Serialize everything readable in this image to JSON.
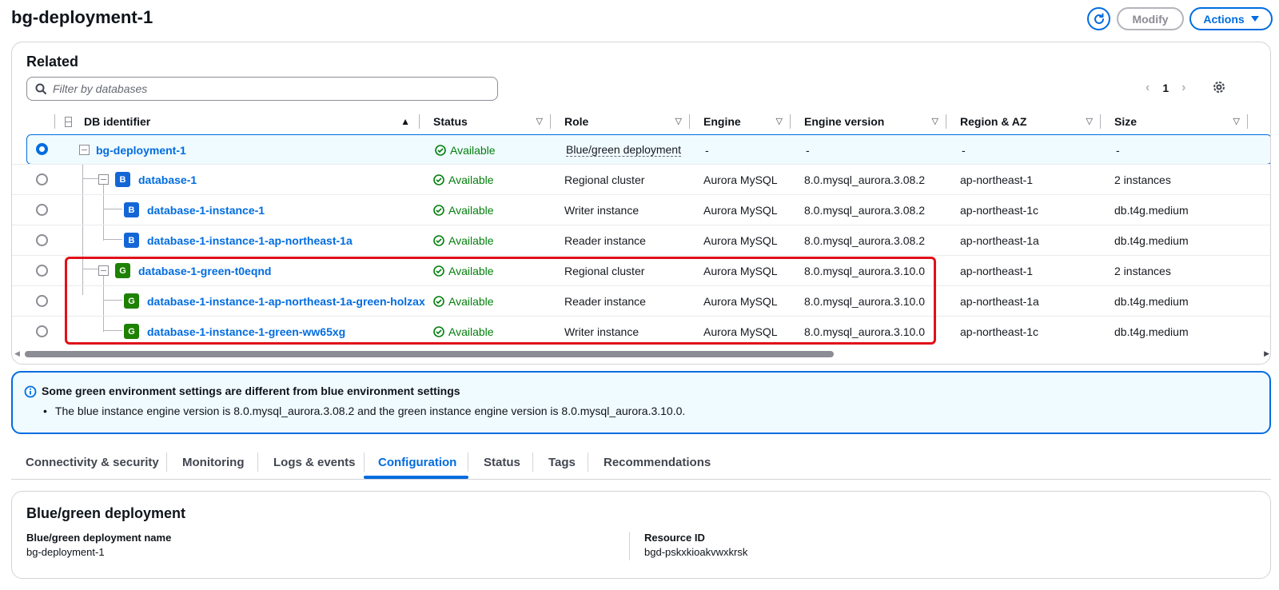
{
  "page": {
    "title": "bg-deployment-1"
  },
  "header_buttons": {
    "modify": "Modify",
    "actions": "Actions"
  },
  "related": {
    "title": "Related",
    "filter_placeholder": "Filter by databases",
    "page_number": "1",
    "columns": [
      "DB identifier",
      "Status",
      "Role",
      "Engine",
      "Engine version",
      "Region & AZ",
      "Size"
    ],
    "rows": [
      {
        "id": "bg-deployment-1",
        "tag": "",
        "status": "Available",
        "role": "Blue/green deployment",
        "engine": "-",
        "version": "-",
        "region": "-",
        "size": "-",
        "selected": true
      },
      {
        "id": "database-1",
        "tag": "B",
        "status": "Available",
        "role": "Regional cluster",
        "engine": "Aurora MySQL",
        "version": "8.0.mysql_aurora.3.08.2",
        "region": "ap-northeast-1",
        "size": "2 instances"
      },
      {
        "id": "database-1-instance-1",
        "tag": "B",
        "status": "Available",
        "role": "Writer instance",
        "engine": "Aurora MySQL",
        "version": "8.0.mysql_aurora.3.08.2",
        "region": "ap-northeast-1c",
        "size": "db.t4g.medium"
      },
      {
        "id": "database-1-instance-1-ap-northeast-1a",
        "tag": "B",
        "status": "Available",
        "role": "Reader instance",
        "engine": "Aurora MySQL",
        "version": "8.0.mysql_aurora.3.08.2",
        "region": "ap-northeast-1a",
        "size": "db.t4g.medium"
      },
      {
        "id": "database-1-green-t0eqnd",
        "tag": "G",
        "status": "Available",
        "role": "Regional cluster",
        "engine": "Aurora MySQL",
        "version": "8.0.mysql_aurora.3.10.0",
        "region": "ap-northeast-1",
        "size": "2 instances"
      },
      {
        "id": "database-1-instance-1-ap-northeast-1a-green-holzax",
        "tag": "G",
        "status": "Available",
        "role": "Reader instance",
        "engine": "Aurora MySQL",
        "version": "8.0.mysql_aurora.3.10.0",
        "region": "ap-northeast-1a",
        "size": "db.t4g.medium"
      },
      {
        "id": "database-1-instance-1-green-ww65xg",
        "tag": "G",
        "status": "Available",
        "role": "Writer instance",
        "engine": "Aurora MySQL",
        "version": "8.0.mysql_aurora.3.10.0",
        "region": "ap-northeast-1c",
        "size": "db.t4g.medium"
      }
    ]
  },
  "alert": {
    "title": "Some green environment settings are different from blue environment settings",
    "bullet": "The blue instance engine version is 8.0.mysql_aurora.3.08.2 and the green instance engine version is 8.0.mysql_aurora.3.10.0."
  },
  "tabs": [
    "Connectivity & security",
    "Monitoring",
    "Logs & events",
    "Configuration",
    "Status",
    "Tags",
    "Recommendations"
  ],
  "active_tab": "Configuration",
  "config": {
    "title": "Blue/green deployment",
    "name_label": "Blue/green deployment name",
    "name_value": "bg-deployment-1",
    "resource_label": "Resource ID",
    "resource_value": "bgd-pskxkioakvwxkrsk"
  },
  "colors": {
    "accent": "#006ce0",
    "available": "#037f0c",
    "blue_tag": "#1466d6",
    "green_tag": "#1d8102",
    "highlight": "#e0101a"
  }
}
